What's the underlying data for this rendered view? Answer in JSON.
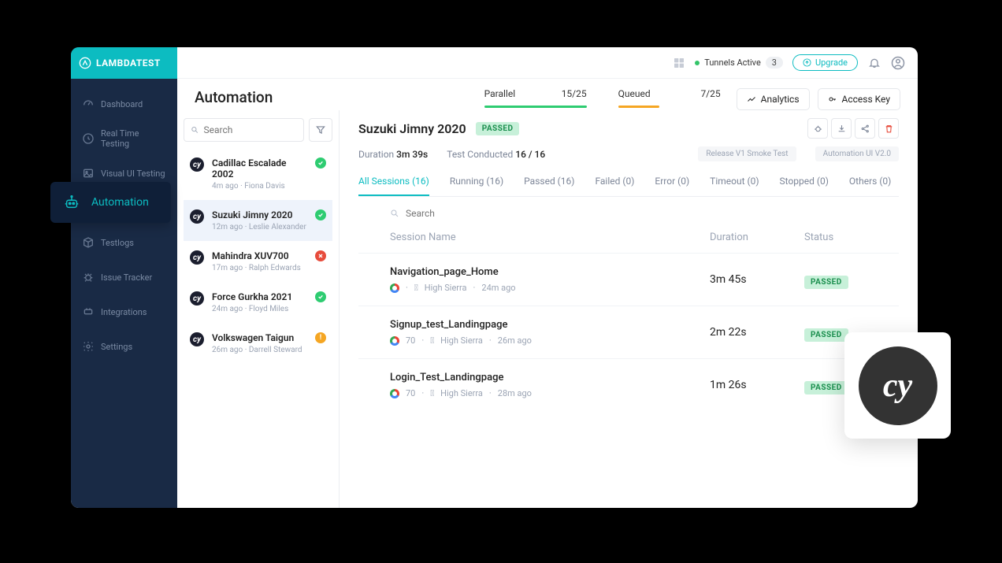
{
  "brand": "LAMBDATEST",
  "sidebar": {
    "items": [
      {
        "label": "Dashboard"
      },
      {
        "label": "Real Time Testing"
      },
      {
        "label": "Visual UI Testing"
      },
      {
        "label": "Automation"
      },
      {
        "label": "Testlogs"
      },
      {
        "label": "Issue Tracker"
      },
      {
        "label": "Integrations"
      },
      {
        "label": "Settings"
      }
    ]
  },
  "flyout_label": "Automation",
  "topbar": {
    "tunnels_label": "Tunnels Active",
    "tunnels_count": "3",
    "upgrade": "Upgrade"
  },
  "header": {
    "title": "Automation",
    "counters": [
      {
        "label": "Parallel",
        "value": "15/25"
      },
      {
        "label": "Queued",
        "value": "7/25"
      }
    ],
    "analytics": "Analytics",
    "access_key": "Access Key"
  },
  "search_placeholder": "Search",
  "builds": [
    {
      "name": "Cadillac Escalade 2002",
      "meta": "4m ago  ·  Fiona Davis",
      "status": "pass"
    },
    {
      "name": "Suzuki Jimny 2020",
      "meta": "12m ago  ·  Leslie Alexander",
      "status": "pass",
      "selected": true
    },
    {
      "name": "Mahindra XUV700",
      "meta": "17m ago  ·  Ralph Edwards",
      "status": "fail"
    },
    {
      "name": "Force Gurkha 2021",
      "meta": "24m ago  ·  Floyd Miles",
      "status": "pass"
    },
    {
      "name": "Volkswagen Taigun",
      "meta": "26m ago  ·  Darrell Steward",
      "status": "warn"
    }
  ],
  "detail": {
    "title": "Suzuki Jimny 2020",
    "status_pill": "PASSED",
    "duration_label": "Duration",
    "duration_value": "3m 39s",
    "conducted_label": "Test Conducted",
    "conducted_value": "16 / 16",
    "tags": [
      "Release V1 Smoke Test",
      "Automation UI V2.0"
    ],
    "tabs": [
      {
        "label": "All Sessions (16)",
        "active": true
      },
      {
        "label": "Running (16)"
      },
      {
        "label": "Passed (16)"
      },
      {
        "label": "Failed (0)"
      },
      {
        "label": "Error (0)"
      },
      {
        "label": "Timeout (0)"
      },
      {
        "label": "Stopped (0)"
      },
      {
        "label": "Others (0)"
      }
    ],
    "table_search_placeholder": "Search",
    "columns": {
      "name": "Session Name",
      "duration": "Duration",
      "status": "Status"
    },
    "rows": [
      {
        "name": "Navigation_page_Home",
        "os": "High Sierra",
        "ago": "24m ago",
        "duration": "3m 45s",
        "status": "PASSED",
        "browser_ver": ""
      },
      {
        "name": "Signup_test_Landingpage",
        "browser_ver": "70",
        "os": "High Sierra",
        "ago": "26m ago",
        "duration": "2m 22s",
        "status": "PASSED"
      },
      {
        "name": "Login_Test_Landingpage",
        "browser_ver": "70",
        "os": "High Sierra",
        "ago": "28m ago",
        "duration": "1m 26s",
        "status": "PASSED"
      }
    ]
  }
}
